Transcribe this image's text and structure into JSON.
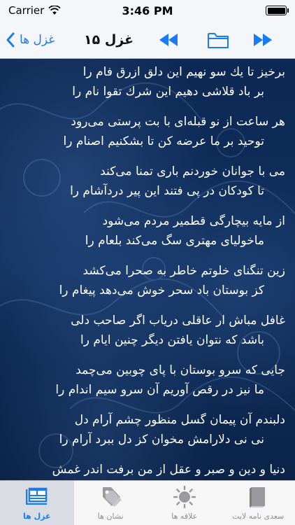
{
  "status_bar": {
    "carrier": "Carrier",
    "time": "3:46 PM"
  },
  "nav": {
    "back_label": "غزل ها",
    "title": "غزل ۱۵",
    "accent_color": "#1a7cf5"
  },
  "poem": {
    "couplets": [
      {
        "first": "برخیز تا یك سو نهیم این دلق ازرق فام را",
        "second": "بر باد قلاشی دهیم این شرك تقوا نام را"
      },
      {
        "first": "هر ساعت از نو قبله‌ای با بت پرستی می‌رود",
        "second": "توحید بر ما عرضه کن تا بشکنیم اصنام را"
      },
      {
        "first": "می با جوانان خوردنم باری تمنا می‌کند",
        "second": "تا کودکان در پی فتند این پیر دردآشام را"
      },
      {
        "first": "از مایه بیچارگی قطمیر مردم می‌شود",
        "second": "ماخولیای مهتری سگ می‌کند بلعام را"
      },
      {
        "first": "زین تنگنای خلوتم خاطر به صحرا می‌کشد",
        "second": "کز بوستان باد سحر خوش می‌دهد پیغام را"
      },
      {
        "first": "غافل مباش ار عاقلی دریاب اگر صاحب دلی",
        "second": "باشد که نتوان یافتن دیگر چنین ایام را"
      },
      {
        "first": "جایی که سرو بوستان با پای چوبین می‌چمد",
        "second": "ما نیز در رقص آوریم آن سرو سیم اندام را"
      },
      {
        "first": "دلبندم آن پیمان گسل منظور چشم آرام دل",
        "second": "نی نی دلارامش مخوان کز دل ببرد آرام را"
      },
      {
        "first": "دنیا و دین و صبر و عقل از من برفت اندر غمش",
        "second": ""
      }
    ]
  },
  "tabs": [
    {
      "label": "غزل ها",
      "icon": "ghazals-icon",
      "active": true
    },
    {
      "label": "نشان ها",
      "icon": "tag-icon",
      "active": false
    },
    {
      "label": "علاقه ها",
      "icon": "sun-icon",
      "active": false
    },
    {
      "label": "سعدی نامه لایت",
      "icon": "book-icon",
      "active": false
    }
  ]
}
